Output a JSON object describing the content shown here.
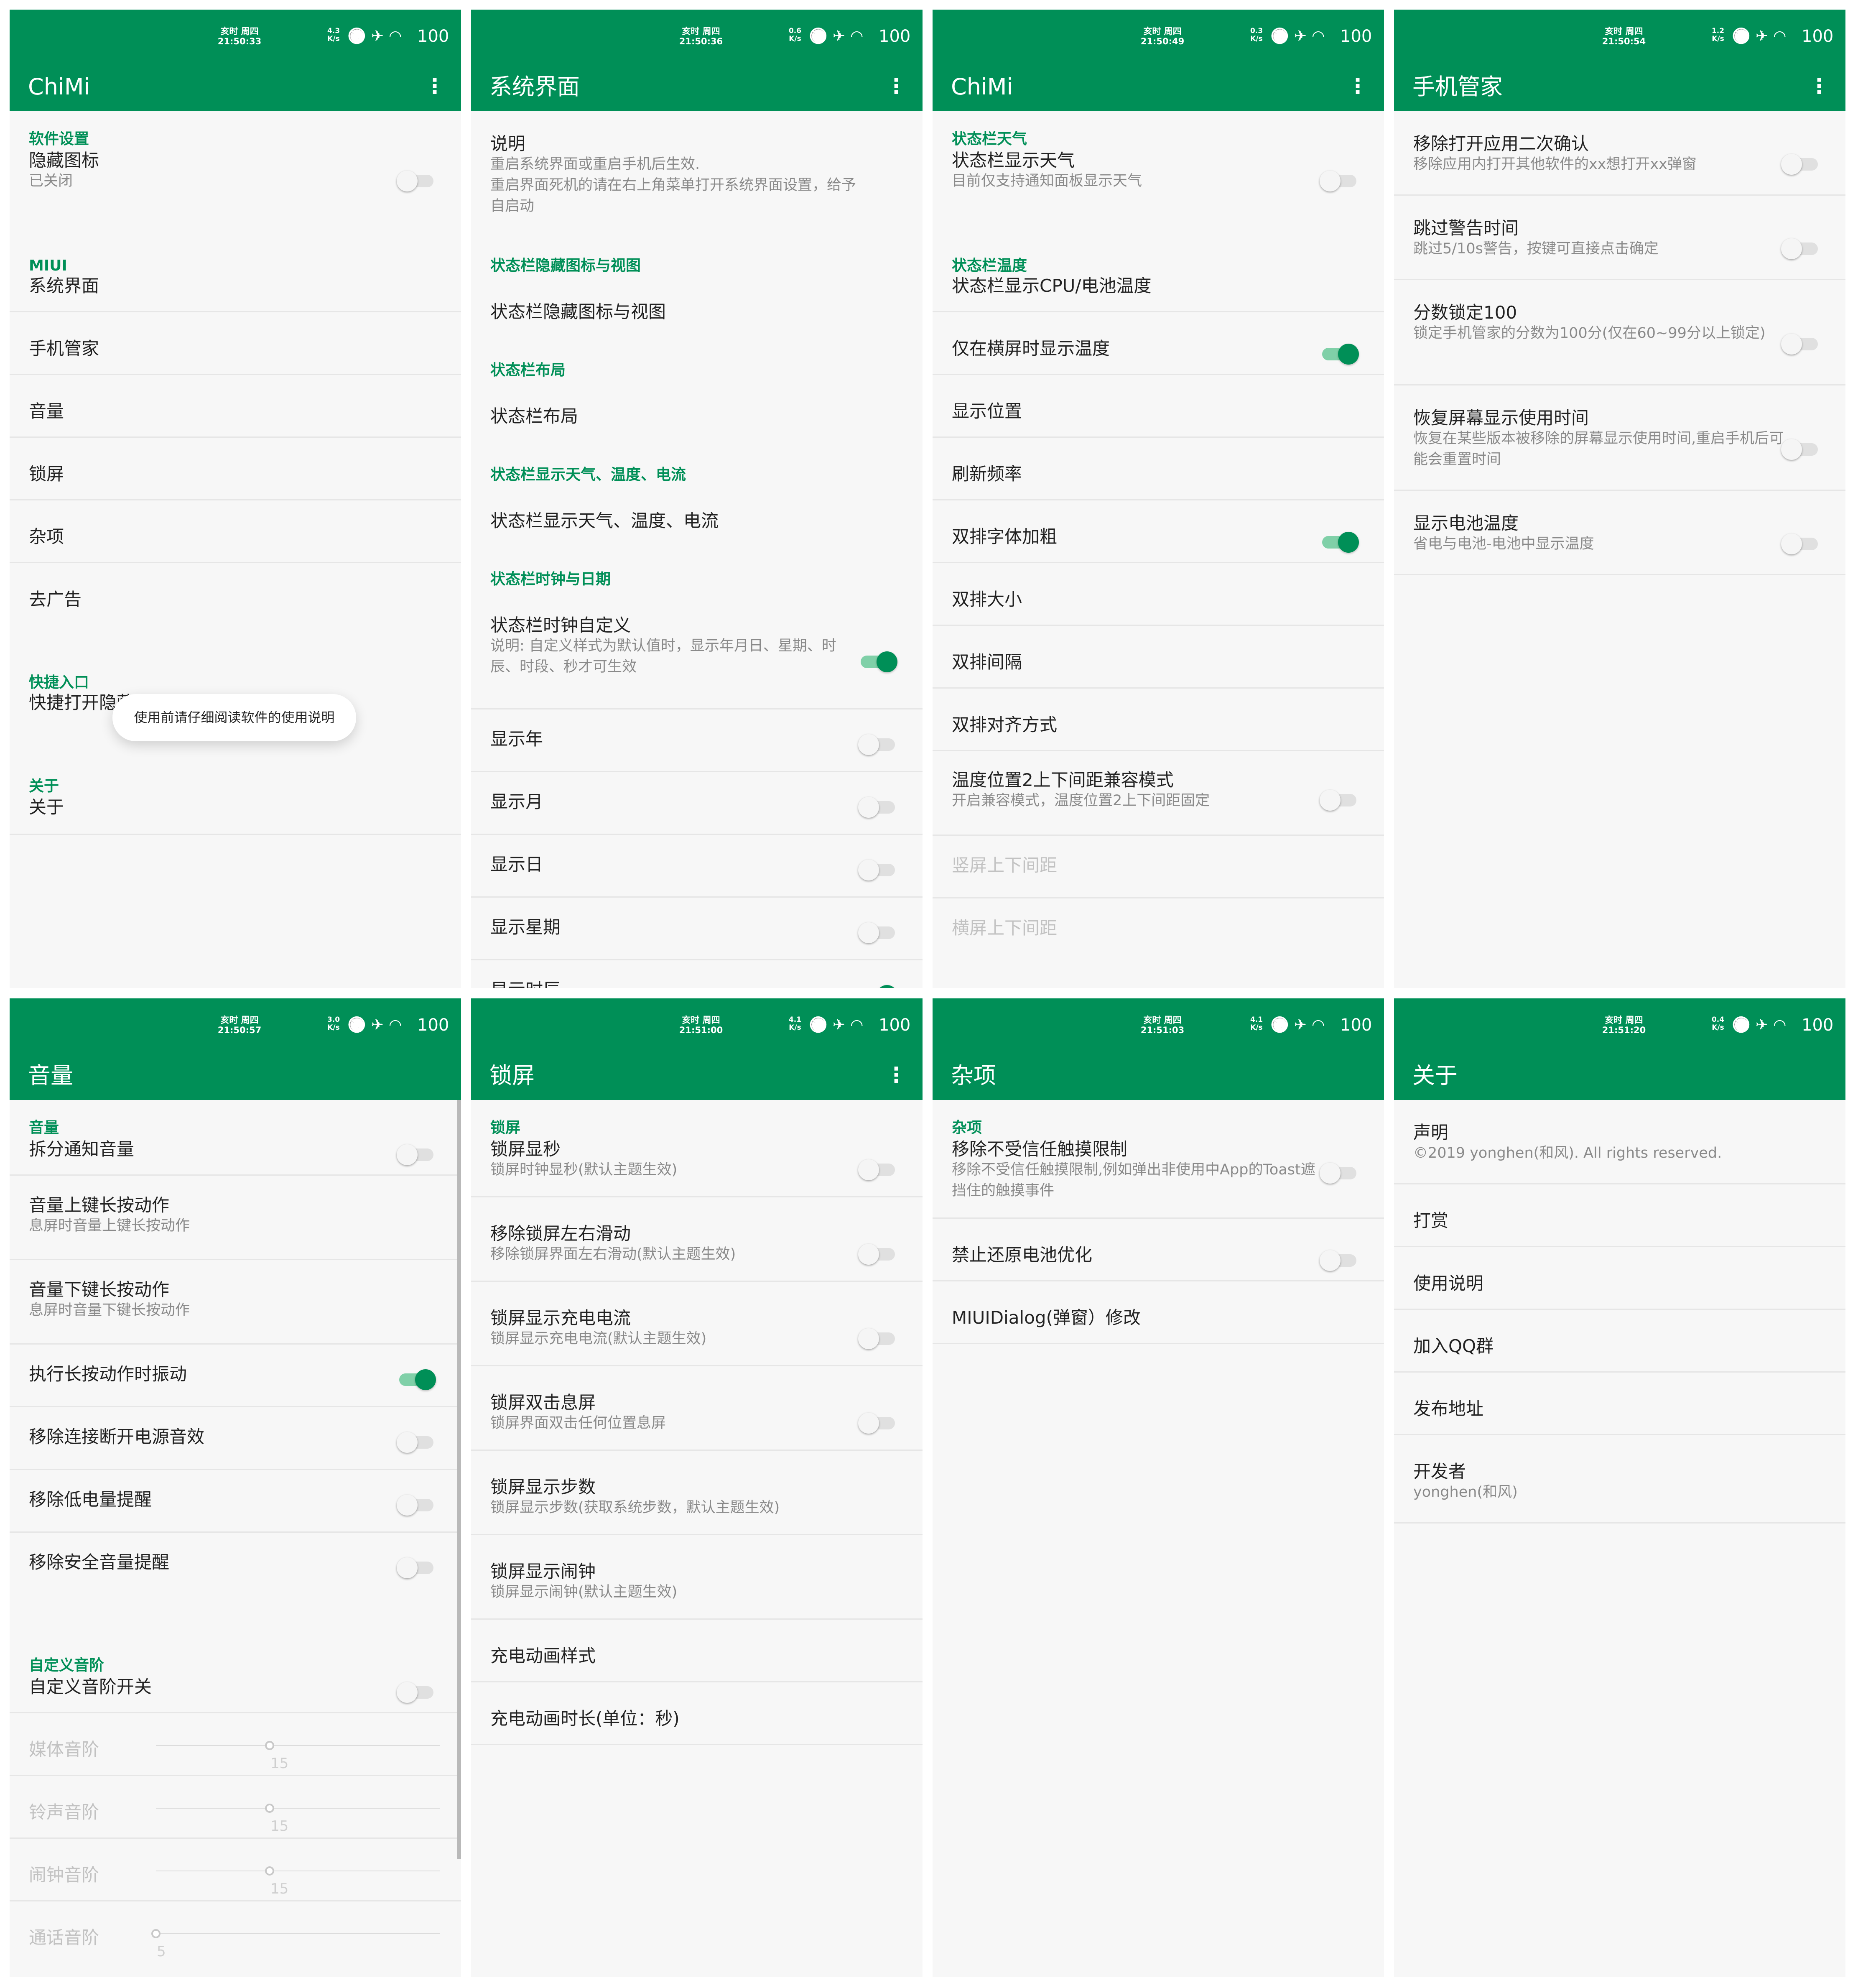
{
  "colors": {
    "accent": "#008f57",
    "background": "#f7f7f7",
    "divider": "#e6e6e6",
    "title": "#222222",
    "summary": "#8a8a8a",
    "disabled": "#c2c2c2"
  },
  "status_bar": {
    "mode": "亥时 周四",
    "icons": [
      "bell-mute-icon",
      "airplane-icon",
      "wifi-icon"
    ],
    "battery": "100",
    "speed_unit": "K/s"
  },
  "menu_icon": "⋮",
  "screens": [
    {
      "id": "s1",
      "time": "21:50:33",
      "speed": "4.3",
      "title": "ChiMi",
      "menu": true,
      "categories": [
        {
          "label": "软件设置"
        },
        {
          "label": "MIUI"
        },
        {
          "label": "快捷入口"
        },
        {
          "label": "关于"
        }
      ],
      "items": [
        {
          "title": "隐藏图标",
          "summary": "已关闭",
          "toggle": "off"
        },
        {
          "title": "系统界面"
        },
        {
          "title": "手机管家"
        },
        {
          "title": "音量"
        },
        {
          "title": "锁屏"
        },
        {
          "title": "杂项"
        },
        {
          "title": "去广告"
        },
        {
          "title": "快捷打开隐藏界面"
        },
        {
          "title": "关于"
        }
      ],
      "toast": "使用前请仔细阅读软件的使用说明"
    },
    {
      "id": "s2",
      "time": "21:50:36",
      "speed": "0.6",
      "title": "系统界面",
      "menu": true,
      "categories": [
        {
          "label": "状态栏隐藏图标与视图"
        },
        {
          "label": "状态栏布局"
        },
        {
          "label": "状态栏显示天气、温度、电流"
        },
        {
          "label": "状态栏时钟与日期"
        }
      ],
      "items": [
        {
          "title": "说明",
          "summary": "重启系统界面或重启手机后生效.\n重启界面死机的请在右上角菜单打开系统界面设置，给予自启动"
        },
        {
          "title": "状态栏隐藏图标与视图"
        },
        {
          "title": "状态栏布局"
        },
        {
          "title": "状态栏显示天气、温度、电流"
        },
        {
          "title": "状态栏时钟自定义",
          "summary": "说明: 自定义样式为默认值时，显示年月日、星期、时辰、时段、秒才可生效",
          "toggle": "on"
        },
        {
          "title": "显示年",
          "toggle": "off"
        },
        {
          "title": "显示月",
          "toggle": "off"
        },
        {
          "title": "显示日",
          "toggle": "off"
        },
        {
          "title": "显示星期",
          "toggle": "off"
        },
        {
          "title": "显示时辰",
          "toggle": "on"
        }
      ]
    },
    {
      "id": "s3",
      "time": "21:50:49",
      "speed": "0.3",
      "title": "ChiMi",
      "menu": true,
      "categories": [
        {
          "label": "状态栏天气"
        },
        {
          "label": "状态栏温度"
        }
      ],
      "items": [
        {
          "title": "状态栏显示天气",
          "summary": "目前仅支持通知面板显示天气",
          "toggle": "off"
        },
        {
          "title": "状态栏显示CPU/电池温度"
        },
        {
          "title": "仅在横屏时显示温度",
          "toggle": "on"
        },
        {
          "title": "显示位置"
        },
        {
          "title": "刷新频率"
        },
        {
          "title": "双排字体加粗",
          "toggle": "on"
        },
        {
          "title": "双排大小"
        },
        {
          "title": "双排间隔"
        },
        {
          "title": "双排对齐方式"
        },
        {
          "title": "温度位置2上下间距兼容模式",
          "summary": "开启兼容模式，温度位置2上下间距固定",
          "toggle": "off"
        },
        {
          "title": "竖屏上下间距",
          "disabled": true
        },
        {
          "title": "横屏上下间距",
          "disabled": true
        }
      ]
    },
    {
      "id": "s4",
      "time": "21:50:54",
      "speed": "1.2",
      "title": "手机管家",
      "menu": true,
      "categories": [],
      "items": [
        {
          "title": "移除打开应用二次确认",
          "summary": "移除应用内打开其他软件的xx想打开xx弹窗",
          "toggle": "off"
        },
        {
          "title": "跳过警告时间",
          "summary": "跳过5/10s警告，按键可直接点击确定",
          "toggle": "off"
        },
        {
          "title": "分数锁定100",
          "summary": "锁定手机管家的分数为100分(仅在60~99分以上锁定)",
          "toggle": "off"
        },
        {
          "title": "恢复屏幕显示使用时间",
          "summary": "恢复在某些版本被移除的屏幕显示使用时间,重启手机后可能会重置时间",
          "toggle": "off"
        },
        {
          "title": "显示电池温度",
          "summary": "省电与电池-电池中显示温度",
          "toggle": "off"
        }
      ]
    },
    {
      "id": "s5",
      "time": "21:50:57",
      "speed": "3.0",
      "title": "音量",
      "menu": false,
      "categories": [
        {
          "label": "音量"
        },
        {
          "label": "自定义音阶"
        }
      ],
      "items": [
        {
          "title": "拆分通知音量",
          "toggle": "off"
        },
        {
          "title": "音量上键长按动作",
          "summary": "息屏时音量上键长按动作"
        },
        {
          "title": "音量下键长按动作",
          "summary": "息屏时音量下键长按动作"
        },
        {
          "title": "执行长按动作时振动",
          "toggle": "on"
        },
        {
          "title": "移除连接断开电源音效",
          "toggle": "off"
        },
        {
          "title": "移除低电量提醒",
          "toggle": "off"
        },
        {
          "title": "移除安全音量提醒",
          "toggle": "off"
        },
        {
          "title": "自定义音阶开关",
          "toggle": "off"
        },
        {
          "title": "媒体音阶",
          "disabled": true,
          "slider": {
            "value": "15",
            "fraction": 0.4
          }
        },
        {
          "title": "铃声音阶",
          "disabled": true,
          "slider": {
            "value": "15",
            "fraction": 0.4
          }
        },
        {
          "title": "闹钟音阶",
          "disabled": true,
          "slider": {
            "value": "15",
            "fraction": 0.4
          }
        },
        {
          "title": "通话音阶",
          "disabled": true,
          "slider": {
            "value": "5",
            "fraction": 0.0
          }
        }
      ]
    },
    {
      "id": "s6",
      "time": "21:51:00",
      "speed": "4.1",
      "title": "锁屏",
      "menu": true,
      "categories": [
        {
          "label": "锁屏"
        }
      ],
      "items": [
        {
          "title": "锁屏显秒",
          "summary": "锁屏时钟显秒(默认主题生效)",
          "toggle": "off"
        },
        {
          "title": "移除锁屏左右滑动",
          "summary": "移除锁屏界面左右滑动(默认主题生效)",
          "toggle": "off"
        },
        {
          "title": "锁屏显示充电电流",
          "summary": "锁屏显示充电电流(默认主题生效)",
          "toggle": "off"
        },
        {
          "title": "锁屏双击息屏",
          "summary": "锁屏界面双击任何位置息屏",
          "toggle": "off"
        },
        {
          "title": "锁屏显示步数",
          "summary": "锁屏显示步数(获取系统步数，默认主题生效)"
        },
        {
          "title": "锁屏显示闹钟",
          "summary": "锁屏显示闹钟(默认主题生效)"
        },
        {
          "title": "充电动画样式"
        },
        {
          "title": "充电动画时长(单位：秒)"
        }
      ]
    },
    {
      "id": "s7",
      "time": "21:51:03",
      "speed": "4.1",
      "title": "杂项",
      "menu": false,
      "categories": [
        {
          "label": "杂项"
        }
      ],
      "items": [
        {
          "title": "移除不受信任触摸限制",
          "summary": "移除不受信任触摸限制,例如弹出非使用中App的Toast遮挡住的触摸事件",
          "toggle": "off"
        },
        {
          "title": "禁止还原电池优化",
          "toggle": "off"
        },
        {
          "title": "MIUIDialog(弹窗）修改"
        }
      ]
    },
    {
      "id": "s8",
      "time": "21:51:20",
      "speed": "0.4",
      "title": "关于",
      "menu": false,
      "categories": [],
      "items": [
        {
          "title": "声明",
          "summary": "©2019 yonghen(和风). All rights reserved."
        },
        {
          "title": "打赏"
        },
        {
          "title": "使用说明"
        },
        {
          "title": "加入QQ群"
        },
        {
          "title": "发布地址"
        },
        {
          "title": "开发者",
          "summary": "yonghen(和风)"
        }
      ]
    }
  ]
}
